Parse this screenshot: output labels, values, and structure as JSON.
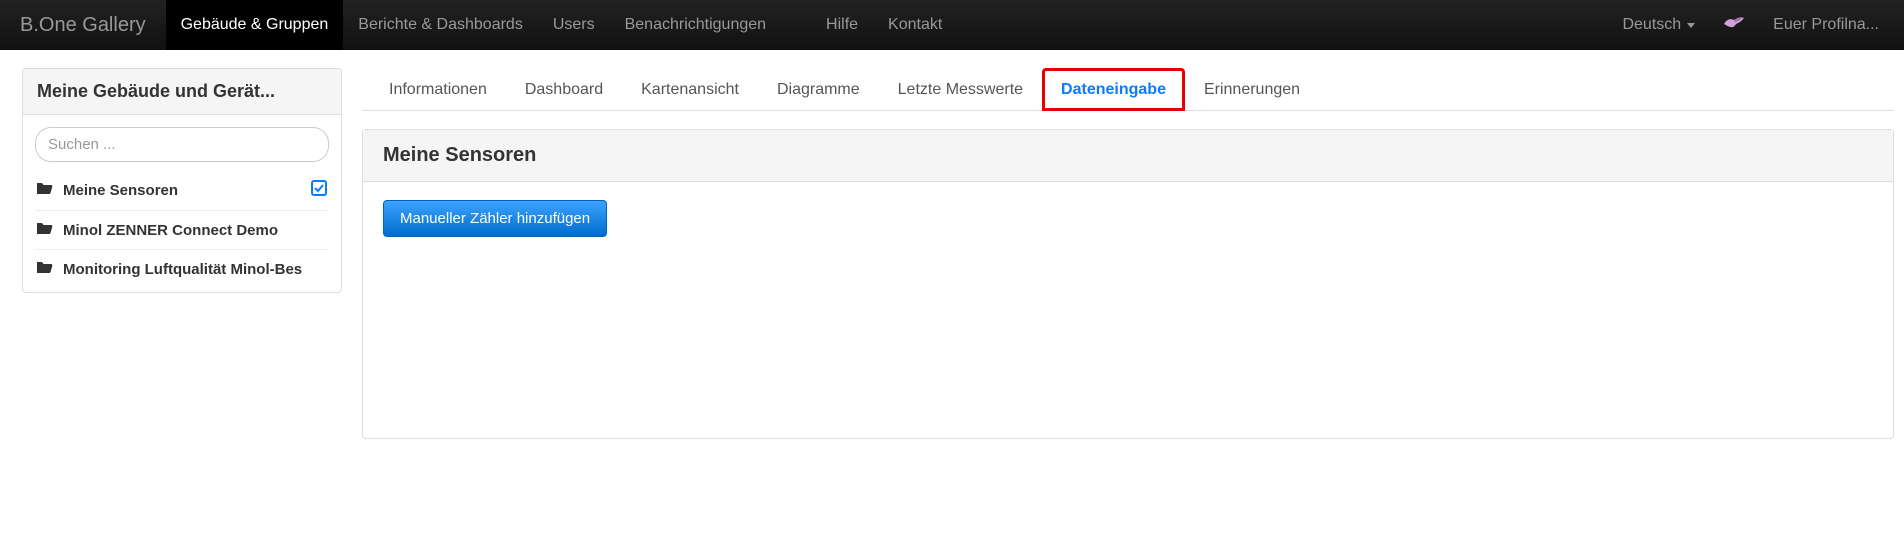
{
  "brand": "B.One Gallery",
  "nav": {
    "left": [
      {
        "label": "Gebäude & Gruppen",
        "active": true
      },
      {
        "label": "Berichte & Dashboards",
        "active": false
      },
      {
        "label": "Users",
        "active": false
      },
      {
        "label": "Benachrichtigungen",
        "active": false
      }
    ],
    "help": "Hilfe",
    "contact": "Kontakt",
    "language": "Deutsch",
    "profile": "Euer Profilna..."
  },
  "sidebar": {
    "title": "Meine Gebäude und Gerät...",
    "search_placeholder": "Suchen ...",
    "items": [
      {
        "label": "Meine Sensoren",
        "selected": true
      },
      {
        "label": "Minol ZENNER Connect Demo",
        "selected": false
      },
      {
        "label": "Monitoring Luftqualität Minol-Bes",
        "selected": false
      }
    ]
  },
  "tabs": [
    {
      "label": "Informationen",
      "active": false
    },
    {
      "label": "Dashboard",
      "active": false
    },
    {
      "label": "Kartenansicht",
      "active": false
    },
    {
      "label": "Diagramme",
      "active": false
    },
    {
      "label": "Letzte Messwerte",
      "active": false
    },
    {
      "label": "Dateneingabe",
      "active": true,
      "highlight": true
    },
    {
      "label": "Erinnerungen",
      "active": false
    }
  ],
  "section": {
    "title": "Meine Sensoren",
    "add_button": "Manueller Zähler hinzufügen"
  },
  "colors": {
    "accent": "#0a7cff",
    "highlight_border": "#e60000"
  }
}
